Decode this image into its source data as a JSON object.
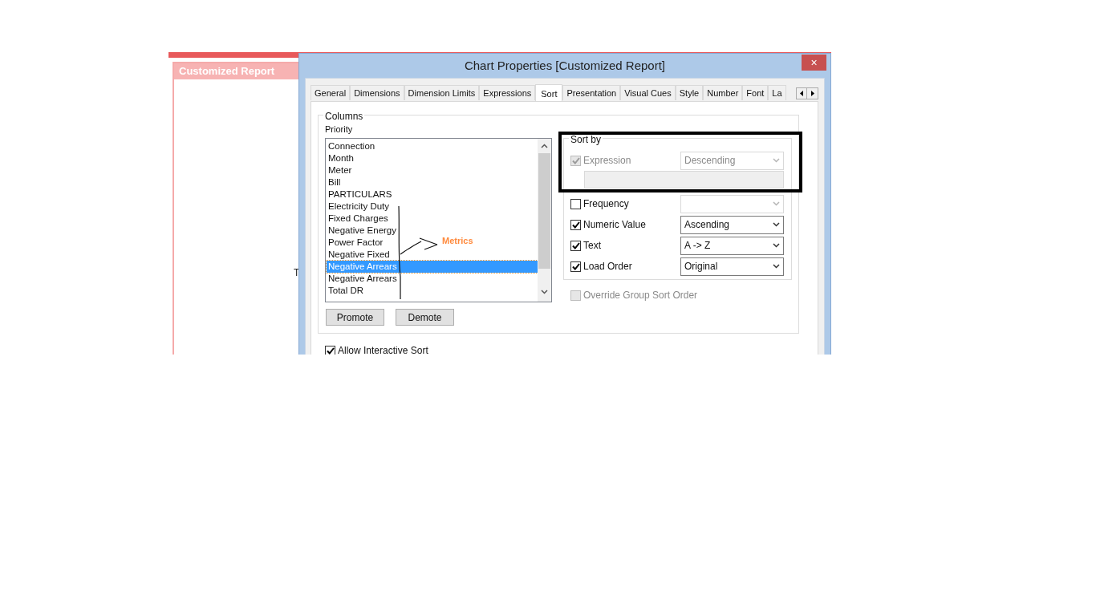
{
  "background_window": {
    "title": "Customized Report",
    "partial_text": "T"
  },
  "dialog": {
    "title": "Chart Properties [Customized Report]",
    "close": "×"
  },
  "tabs": [
    {
      "label": "General",
      "selected": false
    },
    {
      "label": "Dimensions",
      "selected": false
    },
    {
      "label": "Dimension Limits",
      "selected": false
    },
    {
      "label": "Expressions",
      "selected": false
    },
    {
      "label": "Sort",
      "selected": true
    },
    {
      "label": "Presentation",
      "selected": false
    },
    {
      "label": "Visual Cues",
      "selected": false
    },
    {
      "label": "Style",
      "selected": false
    },
    {
      "label": "Number",
      "selected": false
    },
    {
      "label": "Font",
      "selected": false
    },
    {
      "label": "La",
      "selected": false
    }
  ],
  "columns_group": {
    "title": "Columns",
    "priority_label": "Priority",
    "items": [
      {
        "label": "Connection",
        "selected": false
      },
      {
        "label": "Month",
        "selected": false
      },
      {
        "label": "Meter",
        "selected": false
      },
      {
        "label": "Bill",
        "selected": false
      },
      {
        "label": "PARTICULARS",
        "selected": false
      },
      {
        "label": "Electricity Duty",
        "selected": false
      },
      {
        "label": "Fixed Charges",
        "selected": false
      },
      {
        "label": "Negative Energy",
        "selected": false
      },
      {
        "label": "Power Factor",
        "selected": false
      },
      {
        "label": "Negative Fixed",
        "selected": false
      },
      {
        "label": "Negative Arrears",
        "selected": true
      },
      {
        "label": "Negative Arrears",
        "selected": false
      },
      {
        "label": "Total DR",
        "selected": false
      }
    ],
    "buttons": [
      "Promote",
      "Demote"
    ]
  },
  "sort_by": {
    "title": "Sort by",
    "rows": [
      {
        "kind": "expression",
        "label": "Expression",
        "checked": true,
        "disabled": true,
        "value": "Descending",
        "value_disabled": true
      },
      {
        "kind": "plain",
        "label": "Frequency",
        "checked": false,
        "disabled": false,
        "value_disabled": true
      },
      {
        "kind": "plain",
        "label": "Numeric Value",
        "checked": true,
        "disabled": false,
        "value": "Ascending",
        "value_disabled": false
      },
      {
        "kind": "plain",
        "label": "Text",
        "checked": true,
        "disabled": false,
        "value": "A -> Z",
        "value_disabled": false
      },
      {
        "kind": "plain",
        "label": "Load Order",
        "checked": true,
        "disabled": false,
        "value": "Original",
        "value_disabled": false
      }
    ]
  },
  "override_group_sort_order": {
    "label": "Override Group Sort Order",
    "checked": false,
    "disabled": true
  },
  "allow_interactive_sort": {
    "label": "Allow Interactive Sort",
    "checked": true,
    "disabled": false
  },
  "annotation": {
    "label": "Metrics"
  }
}
